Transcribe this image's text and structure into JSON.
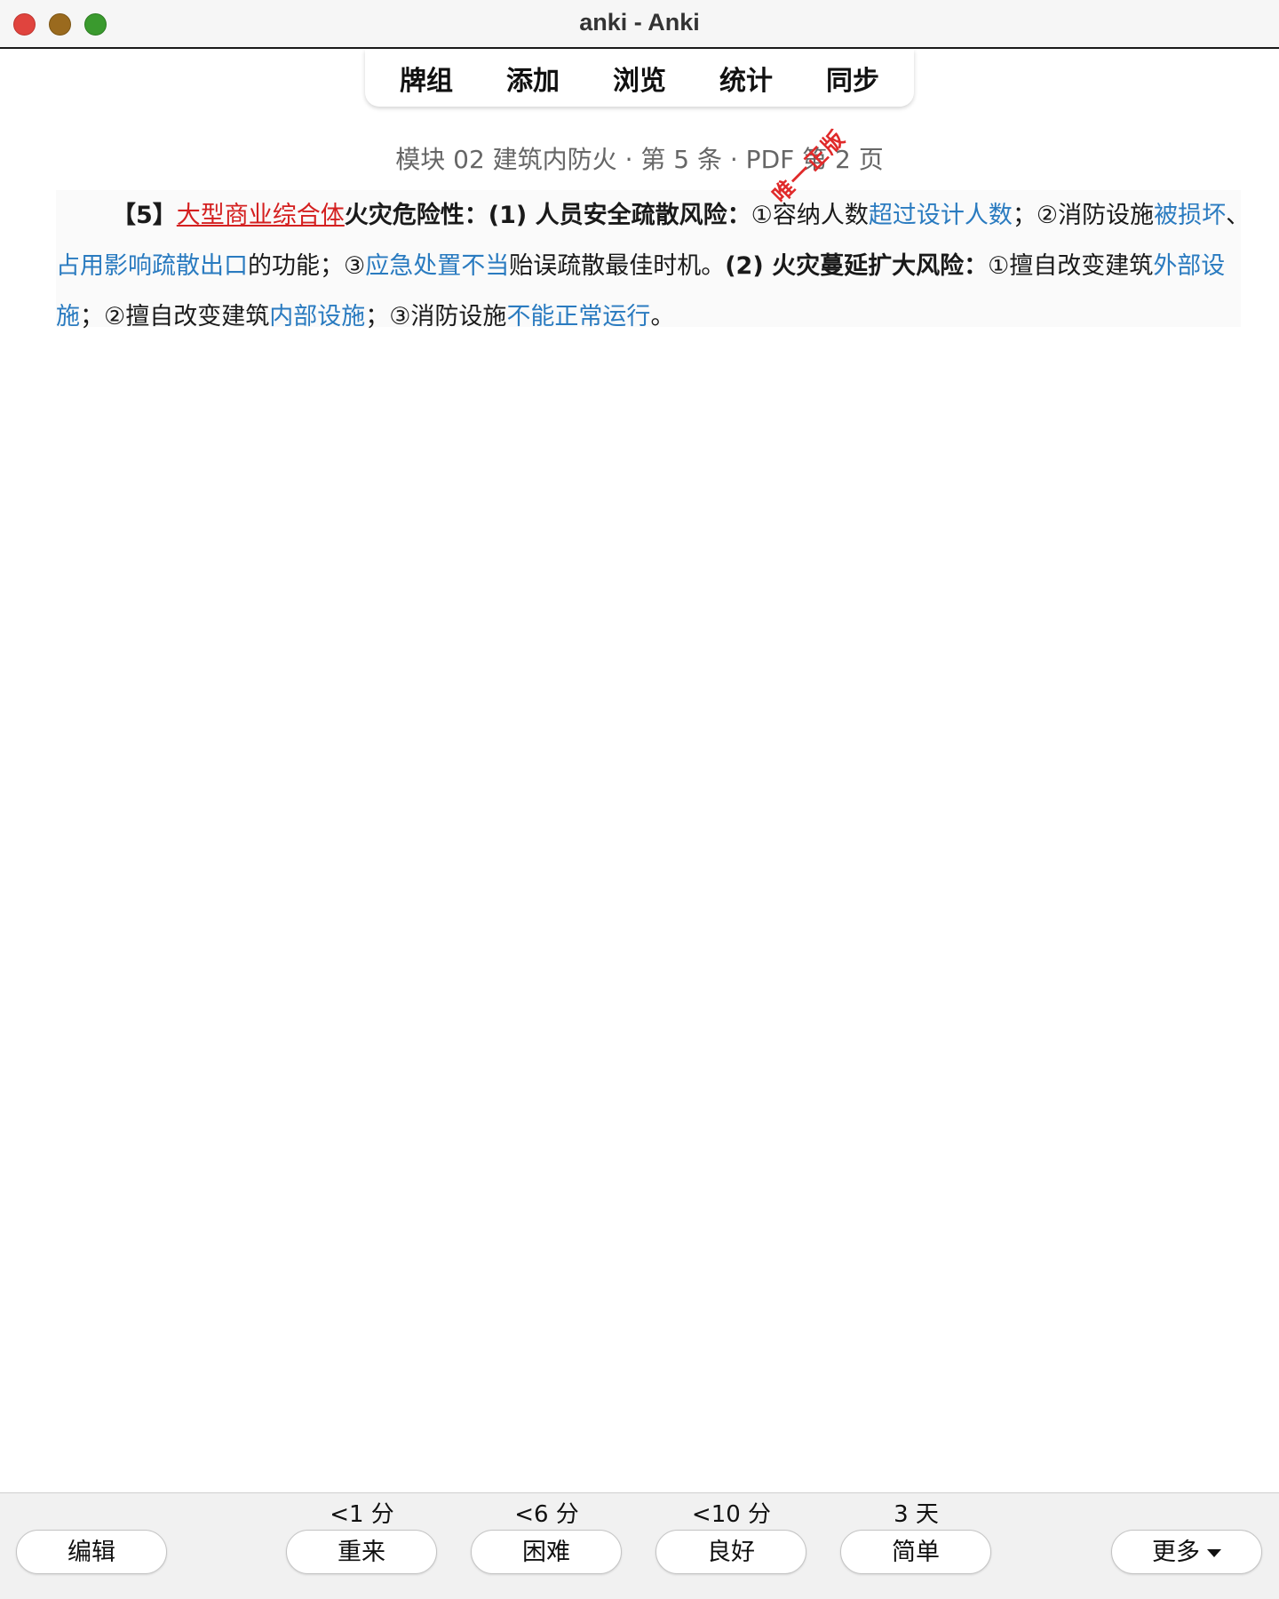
{
  "window": {
    "title": "anki - Anki"
  },
  "topmenu": {
    "items": [
      "牌组",
      "添加",
      "浏览",
      "统计",
      "同步"
    ]
  },
  "card": {
    "header": "模块 02 建筑内防火 · 第 5 条 · PDF 第 2 页",
    "line1": {
      "num": "【5】",
      "keyword": "大型商业综合体",
      "title": "火灾危险性：(1) 人员安全疏散风险：",
      "p1": "①容纳人数",
      "p1b": "超过设计人数",
      "p2": "；②消防设施",
      "p2b": "被损坏",
      "p2c": "、"
    },
    "line2": {
      "b1": "占用影响疏散出口",
      "t1": "的功能；③",
      "b2": "应急处置不当",
      "t2": "贻误疏散最佳时机。",
      "title2": "(2) 火灾蔓延扩大风险：",
      "t3": "①擅自改变建筑",
      "b3": "外部设"
    },
    "line3": {
      "b1": "施",
      "t1": "；②擅自改变建筑",
      "b2": "内部设施",
      "t2": "；③消防设施",
      "b3": "不能正常运行",
      "t3": "。"
    },
    "stamp": "唯一正版"
  },
  "answer_bar": {
    "edit": "编辑",
    "more": "更多",
    "buttons": [
      {
        "label": "重来",
        "interval": "<1 分"
      },
      {
        "label": "困难",
        "interval": "<6 分"
      },
      {
        "label": "良好",
        "interval": "<10 分"
      },
      {
        "label": "简单",
        "interval": "3 天"
      }
    ]
  }
}
